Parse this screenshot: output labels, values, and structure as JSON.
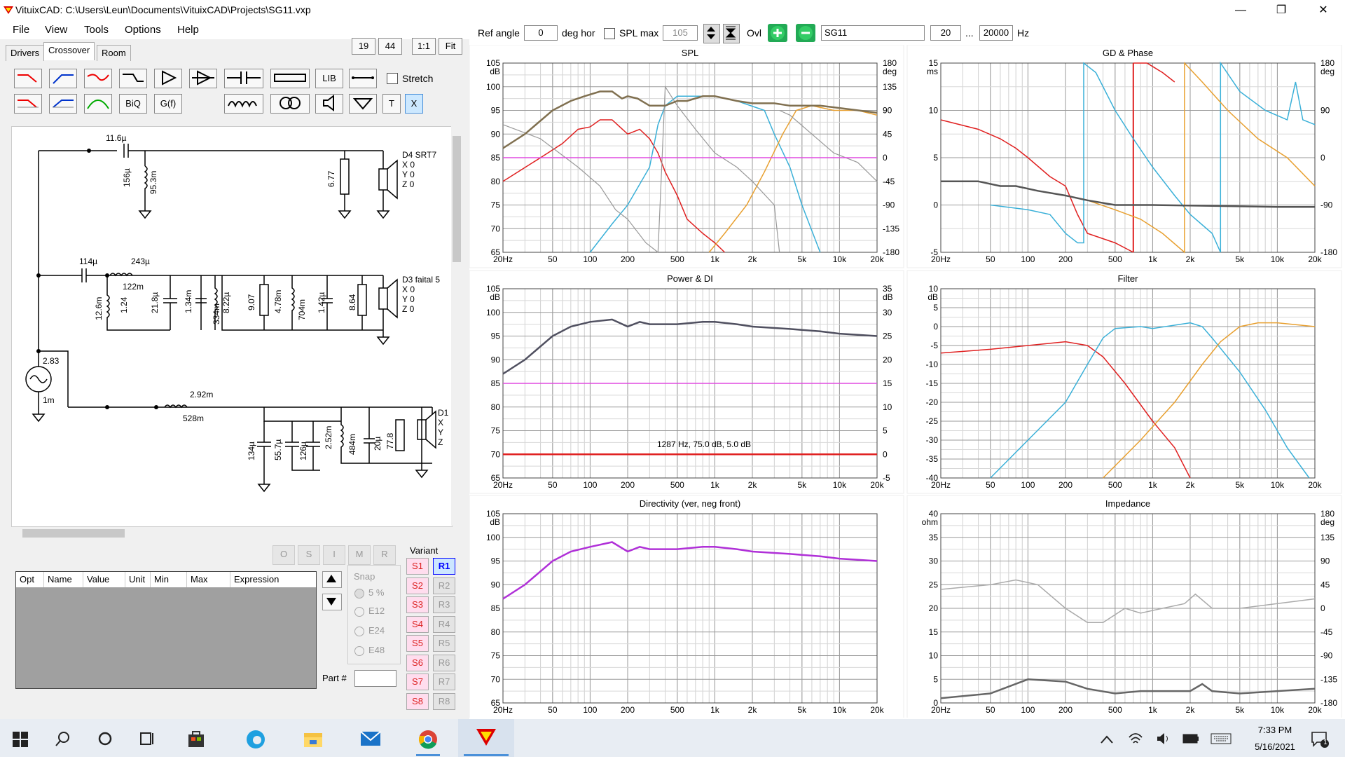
{
  "window": {
    "title": "VituixCAD: C:\\Users\\Leun\\Documents\\VituixCAD\\Projects\\SG11.vxp",
    "minimize": "—",
    "maximize": "❐",
    "close": "✕"
  },
  "menu": [
    "File",
    "View",
    "Tools",
    "Options",
    "Help"
  ],
  "tabs": [
    "Drivers",
    "Crossover",
    "Room"
  ],
  "zoom_buttons": [
    "19",
    "44",
    "1:1",
    "Fit"
  ],
  "toolbar": {
    "biq": "BiQ",
    "gf": "G(f)",
    "lib": "LIB",
    "t": "T",
    "x": "X",
    "stretch": "Stretch"
  },
  "schematic": {
    "labels": [
      "11.6µ",
      "156µ",
      "95.3m",
      "6.77",
      "D4 SRT7",
      "X 0",
      "Y 0",
      "Z 0",
      "114µ",
      "243µ",
      "122m",
      "12.6m",
      "1.24",
      "21.8µ",
      "1.34m",
      "334m",
      "8.22µ",
      "9.07",
      "4.78m",
      "704m",
      "1.42µ",
      "8.64",
      "D3 faital 5",
      "X 0",
      "Y 0",
      "Z 0",
      "2.83",
      "1m",
      "2.92m",
      "528m",
      "134µ",
      "55.7µ",
      "126µ",
      "2.52m",
      "484m",
      "20µ",
      "77.8",
      "D1",
      "X",
      "Y",
      "Z"
    ]
  },
  "bottom": {
    "opt_headers": [
      "Opt",
      "Name",
      "Value",
      "Unit",
      "Min",
      "Max",
      "Expression"
    ],
    "snap": {
      "label": "Snap",
      "options": [
        "5 %",
        "E12",
        "E24",
        "E48"
      ]
    },
    "part_label": "Part #",
    "variant_label": "Variant",
    "variants_s": [
      "S1",
      "S2",
      "S3",
      "S4",
      "S5",
      "S6",
      "S7",
      "S8"
    ],
    "variants_r": [
      "R1",
      "R2",
      "R3",
      "R4",
      "R5",
      "R6",
      "R7",
      "R8"
    ],
    "osimr": [
      "O",
      "S",
      "I",
      "M",
      "R"
    ]
  },
  "header": {
    "ref_angle_label": "Ref angle",
    "ref_angle_value": "0",
    "deg_hor": "deg hor",
    "spl_max_label": "SPL max",
    "spl_max_value": "105",
    "ovl_label": "Ovl",
    "overlay_name": "SG11",
    "f_min": "20",
    "ellipsis": "...",
    "f_max": "20000",
    "hz": "Hz"
  },
  "charts": {
    "x_ticks": [
      "20Hz",
      "50",
      "100",
      "200",
      "500",
      "1k",
      "2k",
      "5k",
      "10k",
      "20k"
    ],
    "spl": {
      "title": "SPL",
      "y_unit": "dB",
      "y_ticks": [
        "105",
        "100",
        "95",
        "90",
        "85",
        "80",
        "75",
        "70",
        "65"
      ],
      "y2_unit": "deg",
      "y2_ticks": [
        "180",
        "135",
        "90",
        "45",
        "0",
        "-45",
        "-90",
        "-135",
        "-180"
      ]
    },
    "gd": {
      "title": "GD & Phase",
      "y_unit": "ms",
      "y_ticks": [
        "15",
        "10",
        "5",
        "0",
        "-5"
      ],
      "y2_unit": "deg",
      "y2_ticks": [
        "180",
        "90",
        "0",
        "-90",
        "-180"
      ]
    },
    "power": {
      "title": "Power & DI",
      "y_unit": "dB",
      "y_ticks": [
        "105",
        "100",
        "95",
        "90",
        "85",
        "80",
        "75",
        "70",
        "65"
      ],
      "y2_unit": "dB",
      "y2_ticks": [
        "35",
        "30",
        "25",
        "20",
        "15",
        "10",
        "5",
        "0",
        "-5"
      ],
      "annotation": "1287 Hz, 75.0 dB, 5.0 dB"
    },
    "filter": {
      "title": "Filter",
      "y_unit": "dB",
      "y_ticks": [
        "10",
        "5",
        "0",
        "-5",
        "-10",
        "-15",
        "-20",
        "-25",
        "-30",
        "-35",
        "-40"
      ]
    },
    "dir": {
      "title": "Directivity (ver, neg front)",
      "y_unit": "dB",
      "y_ticks": [
        "105",
        "100",
        "95",
        "90",
        "85",
        "80",
        "75",
        "70",
        "65"
      ]
    },
    "imp": {
      "title": "Impedance",
      "y_unit": "ohm",
      "y_ticks": [
        "40",
        "35",
        "30",
        "25",
        "20",
        "15",
        "10",
        "5",
        "0"
      ],
      "y2_unit": "deg",
      "y2_ticks": [
        "180",
        "135",
        "90",
        "45",
        "0",
        "-45",
        "-90",
        "-135",
        "-180"
      ]
    }
  },
  "taskbar": {
    "time": "7:33 PM",
    "date": "5/16/2021",
    "notif": "1"
  }
}
